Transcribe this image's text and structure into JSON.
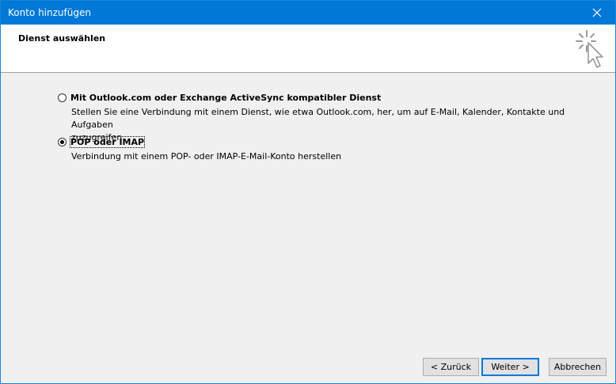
{
  "window": {
    "title": "Konto hinzufügen"
  },
  "header": {
    "heading": "Dienst auswählen"
  },
  "options": [
    {
      "label": "Mit Outlook.com oder Exchange ActiveSync kompatibler Dienst",
      "description_line1": "Stellen Sie eine Verbindung mit einem Dienst, wie etwa Outlook.com, her, um auf E-Mail, Kalender, Kontakte und Aufgaben",
      "description_line2": "zuzugreifen",
      "selected": false
    },
    {
      "label": "POP oder IMAP",
      "description_line1": "Verbindung mit einem POP- oder IMAP-E-Mail-Konto herstellen",
      "selected": true
    }
  ],
  "buttons": {
    "back": "< Zurück",
    "next": "Weiter >",
    "cancel": "Abbrechen"
  },
  "icons": {
    "close": "close-icon",
    "header_graphic": "cursor-click-icon"
  },
  "colors": {
    "titlebar": "#0078d7",
    "accent": "#0078d7"
  }
}
